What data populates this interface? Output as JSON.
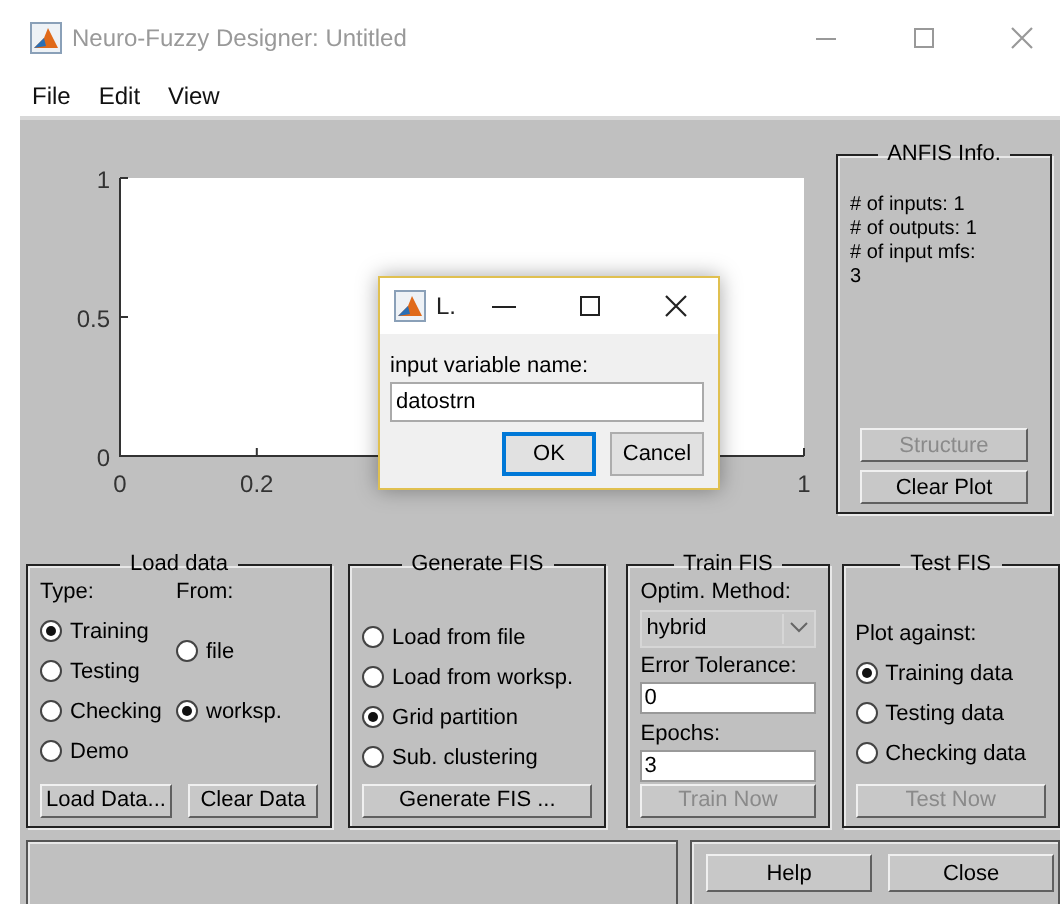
{
  "window": {
    "title": "Neuro-Fuzzy Designer: Untitled"
  },
  "menu": [
    "File",
    "Edit",
    "View"
  ],
  "plot": {
    "chart_data": {
      "type": "line",
      "xlim": [
        0,
        1
      ],
      "ylim": [
        0,
        1
      ],
      "xticks": [
        0,
        0.2,
        1
      ],
      "yticks": [
        0,
        0.5,
        1
      ]
    }
  },
  "anfis_info": {
    "title": "ANFIS Info.",
    "lines": [
      "# of inputs: 1",
      "# of outputs: 1",
      "# of input mfs:",
      "3"
    ],
    "buttons": [
      {
        "label": "Structure",
        "disabled": true
      },
      {
        "label": "Clear Plot",
        "disabled": false
      }
    ]
  },
  "load_data": {
    "title": "Load data",
    "type_label": "Type:",
    "from_label": "From:",
    "types": [
      {
        "label": "Training",
        "selected": true
      },
      {
        "label": "Testing",
        "selected": false
      },
      {
        "label": "Checking",
        "selected": false
      },
      {
        "label": "Demo",
        "selected": false
      }
    ],
    "sources": [
      {
        "label": "file",
        "selected": false
      },
      {
        "label": "worksp.",
        "selected": true
      }
    ],
    "buttons": [
      {
        "label": "Load Data...",
        "disabled": false
      },
      {
        "label": "Clear Data",
        "disabled": false
      }
    ]
  },
  "generate_fis": {
    "title": "Generate FIS",
    "options": [
      {
        "label": "Load from file",
        "selected": false
      },
      {
        "label": "Load from worksp.",
        "selected": false
      },
      {
        "label": "Grid partition",
        "selected": true
      },
      {
        "label": "Sub. clustering",
        "selected": false
      }
    ],
    "button": {
      "label": "Generate FIS ...",
      "disabled": false
    }
  },
  "train_fis": {
    "title": "Train FIS",
    "method_label": "Optim. Method:",
    "method": "hybrid",
    "tolerance_label": "Error Tolerance:",
    "tolerance": "0",
    "epochs_label": "Epochs:",
    "epochs": "3",
    "button": {
      "label": "Train Now",
      "disabled": true
    }
  },
  "test_fis": {
    "title": "Test FIS",
    "plot_label": "Plot against:",
    "options": [
      {
        "label": "Training data",
        "selected": true
      },
      {
        "label": "Testing data",
        "selected": false
      },
      {
        "label": "Checking data",
        "selected": false
      }
    ],
    "button": {
      "label": "Test Now",
      "disabled": true
    }
  },
  "footer_buttons": [
    "Help",
    "Close"
  ],
  "dialog": {
    "title": "L.",
    "prompt": "input variable name:",
    "value": "datostrn",
    "buttons": [
      {
        "label": "OK",
        "default": true
      },
      {
        "label": "Cancel",
        "default": false
      }
    ]
  }
}
